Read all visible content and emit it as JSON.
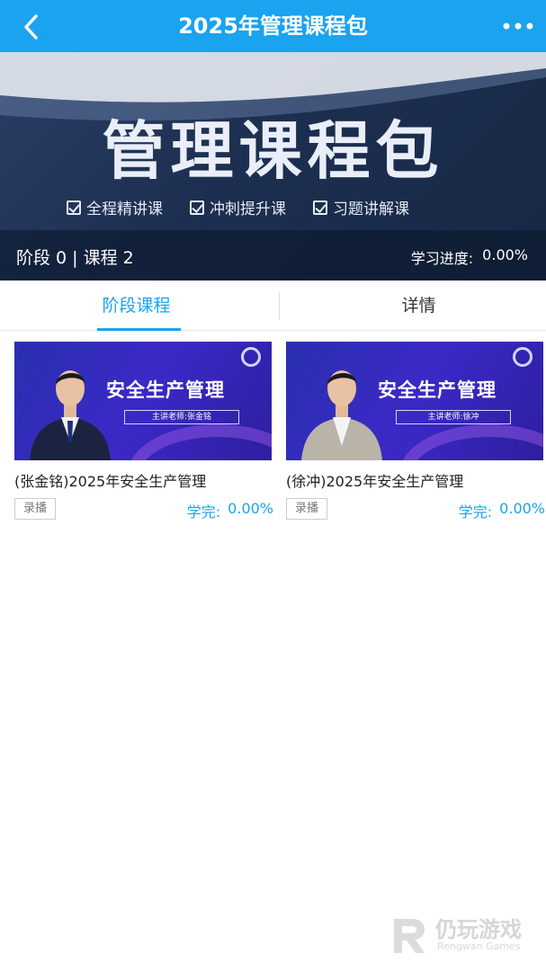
{
  "header": {
    "title": "2025年管理课程包",
    "back_icon": "chevron-left-icon",
    "more_icon": "more-dots-icon"
  },
  "banner": {
    "title": "管理课程包",
    "features": [
      "全程精讲课",
      "冲刺提升课",
      "习题讲解课"
    ],
    "stage_info": "阶段 0 | 课程 2",
    "progress_label": "学习进度:",
    "progress_value": "0.00%"
  },
  "tabs": {
    "stage_courses": "阶段课程",
    "details": "详情"
  },
  "courses": [
    {
      "thumb_title": "安全生产管理",
      "thumb_teacher": "主讲老师:张金铭",
      "name": "(张金铭)2025年安全生产管理",
      "tag": "录播",
      "done_label": "学完:",
      "done_value": "0.00%"
    },
    {
      "thumb_title": "安全生产管理",
      "thumb_teacher": "主讲老师:徐冲",
      "name": "(徐冲)2025年安全生产管理",
      "tag": "录播",
      "done_label": "学完:",
      "done_value": "0.00%"
    }
  ],
  "watermark": {
    "text": "仍玩游戏",
    "sub": "Rengwan Games"
  },
  "colors": {
    "accent": "#1aa3ee",
    "banner": "#1d2f50",
    "thumb": "#3b29c6"
  }
}
